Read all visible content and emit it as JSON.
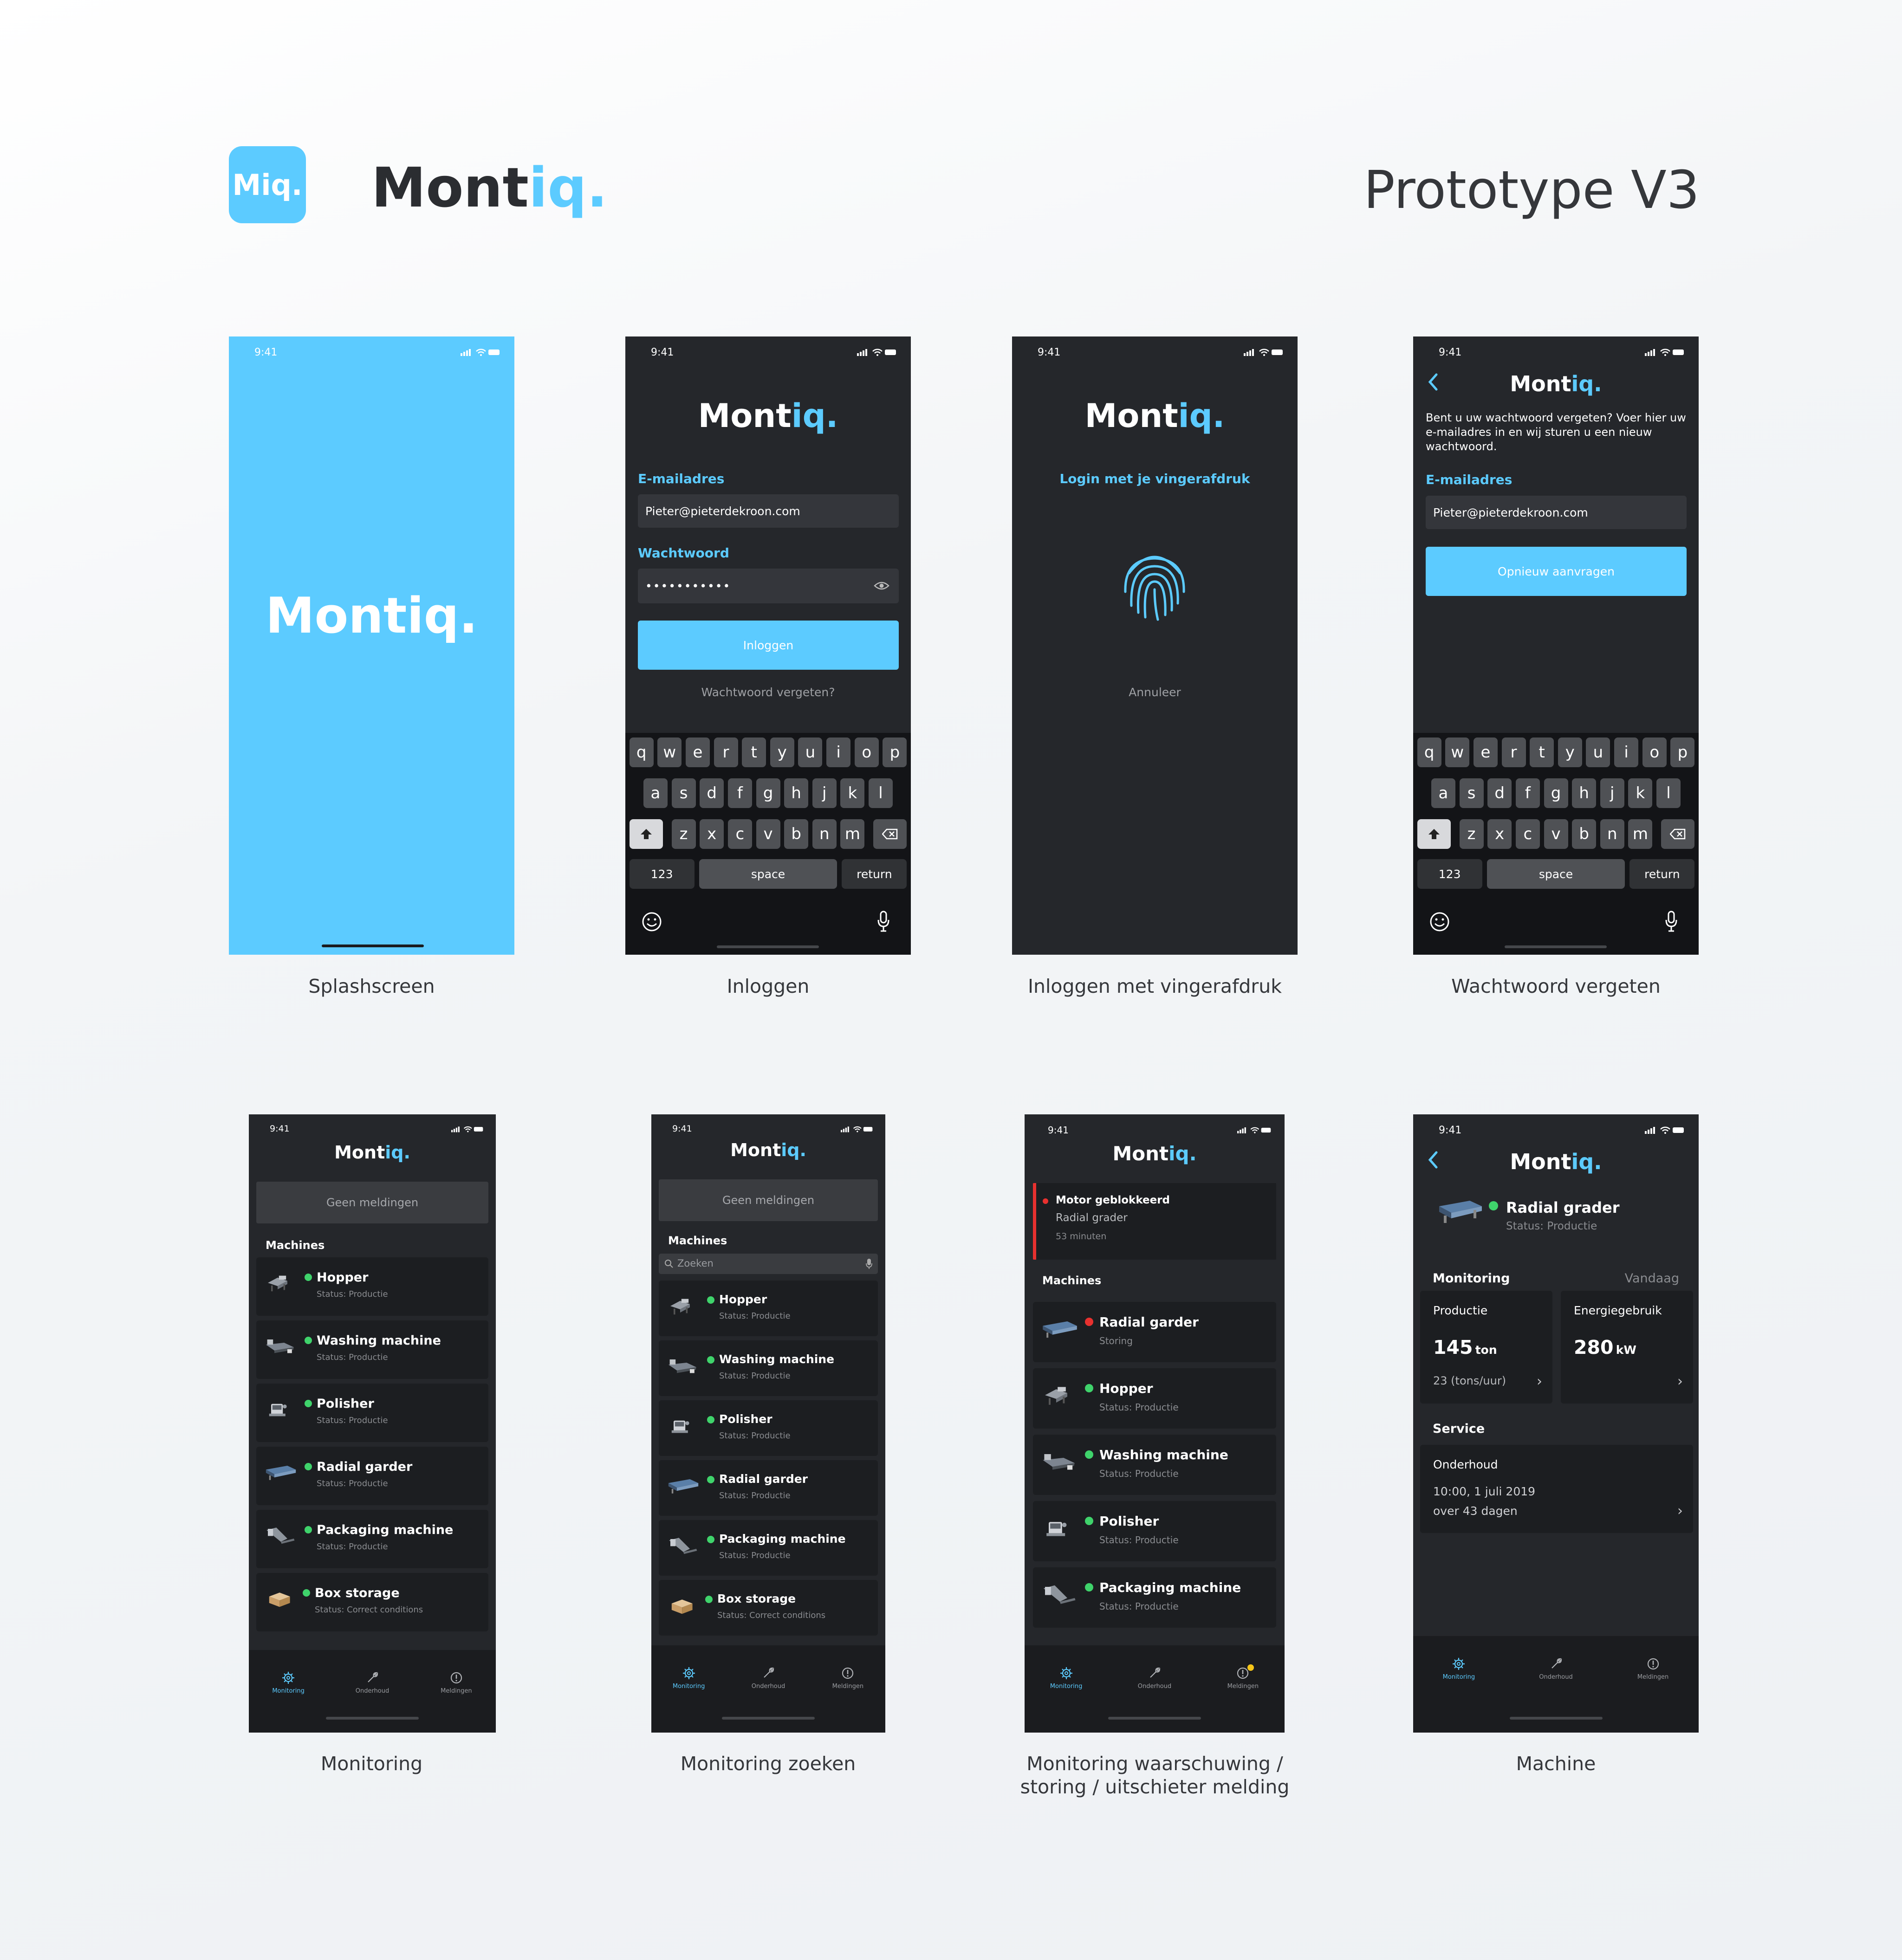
{
  "header": {
    "app_icon_text": "Miq.",
    "logo_main": "Mont",
    "logo_accent": "iq",
    "logo_dot": ".",
    "title": "Prototype V3"
  },
  "colors": {
    "accent": "#5ccbff",
    "screen_bg": "#25272b",
    "status_ok": "#3fd36b",
    "status_error": "#e8312f",
    "badge": "#f5c518"
  },
  "status_time": "9:41",
  "captions": {
    "splash": "Splashscreen",
    "login": "Inloggen",
    "fingerprint": "Inloggen met vingerafdruk",
    "forgot": "Wachtwoord vergeten",
    "monitoring": "Monitoring",
    "monitoring_search": "Monitoring zoeken",
    "warning_line1": "Monitoring waarschuwing /",
    "warning_line2": "storing / uitschieter melding",
    "machine": "Machine"
  },
  "login": {
    "email_label": "E-mailadres",
    "email_value": "Pieter@pieterdekroon.com",
    "password_label": "Wachtwoord",
    "password_value": "•••••••••••",
    "login_button": "Inloggen",
    "forgot_link": "Wachtwoord vergeten?"
  },
  "fingerprint": {
    "prompt": "Login met je vingerafdruk",
    "cancel": "Annuleer"
  },
  "forgot": {
    "description": "Bent u uw wachtwoord vergeten? Voer hier uw e-mailadres in en wij sturen u een nieuw wachtwoord.",
    "email_label": "E-mailadres",
    "email_value": "Pieter@pieterdekroon.com",
    "button": "Opnieuw aanvragen"
  },
  "keyboard": {
    "row1": [
      "q",
      "w",
      "e",
      "r",
      "t",
      "y",
      "u",
      "i",
      "o",
      "p"
    ],
    "row2": [
      "a",
      "s",
      "d",
      "f",
      "g",
      "h",
      "j",
      "k",
      "l"
    ],
    "row3": [
      "z",
      "x",
      "c",
      "v",
      "b",
      "n",
      "m"
    ],
    "numbers": "123",
    "space": "space",
    "return": "return"
  },
  "monitoring": {
    "no_alerts": "Geen meldingen",
    "machines_title": "Machines",
    "search_placeholder": "Zoeken",
    "machines": [
      {
        "name": "Hopper",
        "status": "Status: Productie"
      },
      {
        "name": "Washing machine",
        "status": "Status: Productie"
      },
      {
        "name": "Polisher",
        "status": "Status: Productie"
      },
      {
        "name": "Radial garder",
        "status": "Status: Productie"
      },
      {
        "name": "Packaging machine",
        "status": "Status: Productie"
      },
      {
        "name": "Box storage",
        "status": "Status: Correct conditions"
      }
    ]
  },
  "warning": {
    "alert_title": "Motor geblokkeerd",
    "alert_machine": "Radial grader",
    "alert_time": "53 minuten",
    "machines_title": "Machines",
    "machines": [
      {
        "name": "Radial garder",
        "status": "Storing",
        "state": "error"
      },
      {
        "name": "Hopper",
        "status": "Status: Productie",
        "state": "ok"
      },
      {
        "name": "Washing machine",
        "status": "Status: Productie",
        "state": "ok"
      },
      {
        "name": "Polisher",
        "status": "Status: Productie",
        "state": "ok"
      },
      {
        "name": "Packaging machine",
        "status": "Status: Productie",
        "state": "ok"
      }
    ]
  },
  "tabs": {
    "monitoring": "Monitoring",
    "maintenance": "Onderhoud",
    "notifications": "Meldingen"
  },
  "machine": {
    "name": "Radial grader",
    "status": "Status: Productie",
    "monitoring_title": "Monitoring",
    "period": "Vandaag",
    "production_label": "Productie",
    "production_value": "145",
    "production_unit": "ton",
    "production_rate": "23 (tons/uur)",
    "energy_label": "Energiegebruik",
    "energy_value": "280",
    "energy_unit": "kW",
    "service_title": "Service",
    "service_label": "Onderhoud",
    "service_date": "10:00, 1 juli 2019",
    "service_due": "over 43 dagen"
  }
}
